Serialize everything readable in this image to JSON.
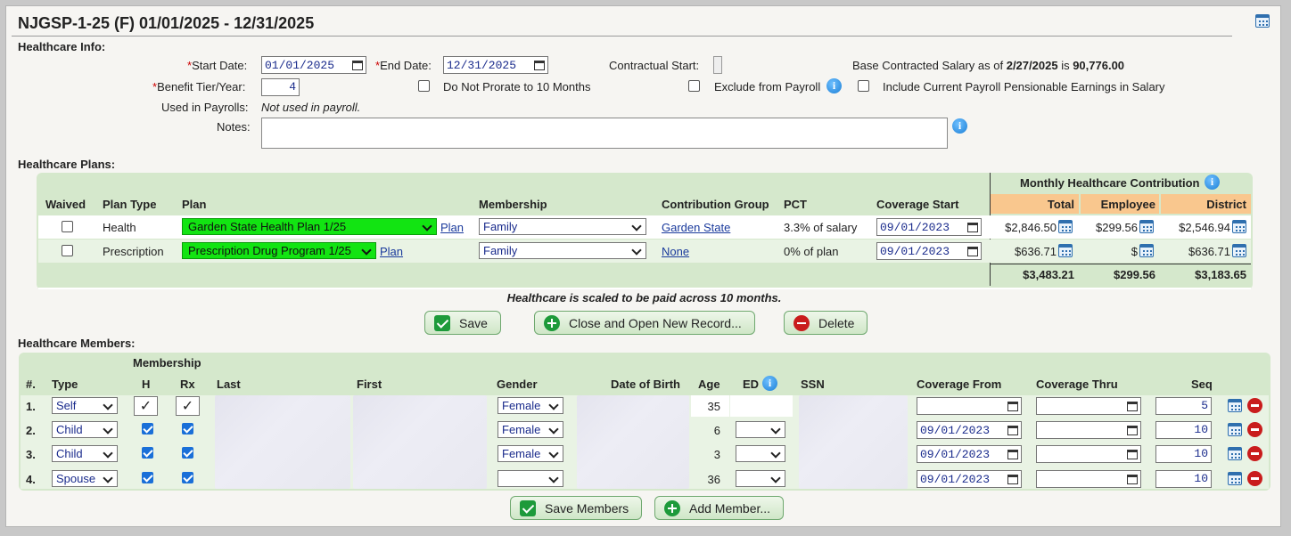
{
  "header": {
    "title": "NJGSP-1-25 (F) 01/01/2025 - 12/31/2025"
  },
  "healthcare_info": {
    "section_label": "Healthcare Info:",
    "start_date_label": "Start Date:",
    "start_date": "01/01/2025",
    "end_date_label": "End Date:",
    "end_date": "12/31/2025",
    "contractual_start_label": "Contractual Start:",
    "base_salary_prefix": "Base Contracted Salary as of",
    "base_salary_date": "2/27/2025",
    "base_salary_is": "is",
    "base_salary_value": "90,776.00",
    "benefit_tier_label": "Benefit Tier/Year:",
    "benefit_tier": "4",
    "do_not_prorate_label": "Do Not Prorate to 10 Months",
    "exclude_payroll_label": "Exclude from Payroll",
    "include_pensionable_label": "Include Current Payroll Pensionable Earnings in Salary",
    "used_in_payrolls_label": "Used in Payrolls:",
    "used_in_payrolls_value": "Not used in payroll.",
    "notes_label": "Notes:",
    "required_mark": "*"
  },
  "plans": {
    "section_label": "Healthcare Plans:",
    "monthly_header": "Monthly Healthcare Contribution",
    "columns": [
      "Waived",
      "Plan Type",
      "Plan",
      "Membership",
      "Contribution Group",
      "PCT",
      "Coverage Start",
      "Total",
      "Employee",
      "District"
    ],
    "plan_link": "Plan",
    "rows": [
      {
        "type": "Health",
        "plan": "Garden State Health Plan 1/25",
        "membership": "Family",
        "group": "Garden State",
        "pct": "3.3% of salary",
        "coverage_start": "09/01/2023",
        "total": "$2,846.50",
        "employee": "$299.56",
        "district": "$2,546.94"
      },
      {
        "type": "Prescription",
        "plan": "Prescription Drug Program 1/25",
        "membership": "Family",
        "group": "None",
        "pct": "0% of plan",
        "coverage_start": "09/01/2023",
        "total": "$636.71",
        "employee": "$",
        "district": "$636.71"
      }
    ],
    "totals": {
      "total": "$3,483.21",
      "employee": "$299.56",
      "district": "$3,183.65"
    },
    "scaled_note": "Healthcare is scaled to be paid across 10 months."
  },
  "actions": {
    "save": "Save",
    "close_open": "Close and Open New Record...",
    "delete": "Delete"
  },
  "members": {
    "section_label": "Healthcare Members:",
    "membership_header": "Membership",
    "columns": [
      "#.",
      "Type",
      "H",
      "Rx",
      "Last",
      "First",
      "Gender",
      "Date of Birth",
      "Age",
      "ED",
      "SSN",
      "Coverage From",
      "Coverage Thru",
      "Seq"
    ],
    "rows": [
      {
        "num": "1.",
        "type": "Self",
        "gender": "Female",
        "age": "35",
        "coverage_from": "",
        "seq": "5"
      },
      {
        "num": "2.",
        "type": "Child",
        "gender": "Female",
        "age": "6",
        "coverage_from": "09/01/2023",
        "seq": "10"
      },
      {
        "num": "3.",
        "type": "Child",
        "gender": "Female",
        "age": "3",
        "coverage_from": "09/01/2023",
        "seq": "10"
      },
      {
        "num": "4.",
        "type": "Spouse",
        "gender": "",
        "age": "36",
        "coverage_from": "09/01/2023",
        "seq": "10"
      }
    ],
    "save_members": "Save Members",
    "add_member": "Add Member..."
  }
}
